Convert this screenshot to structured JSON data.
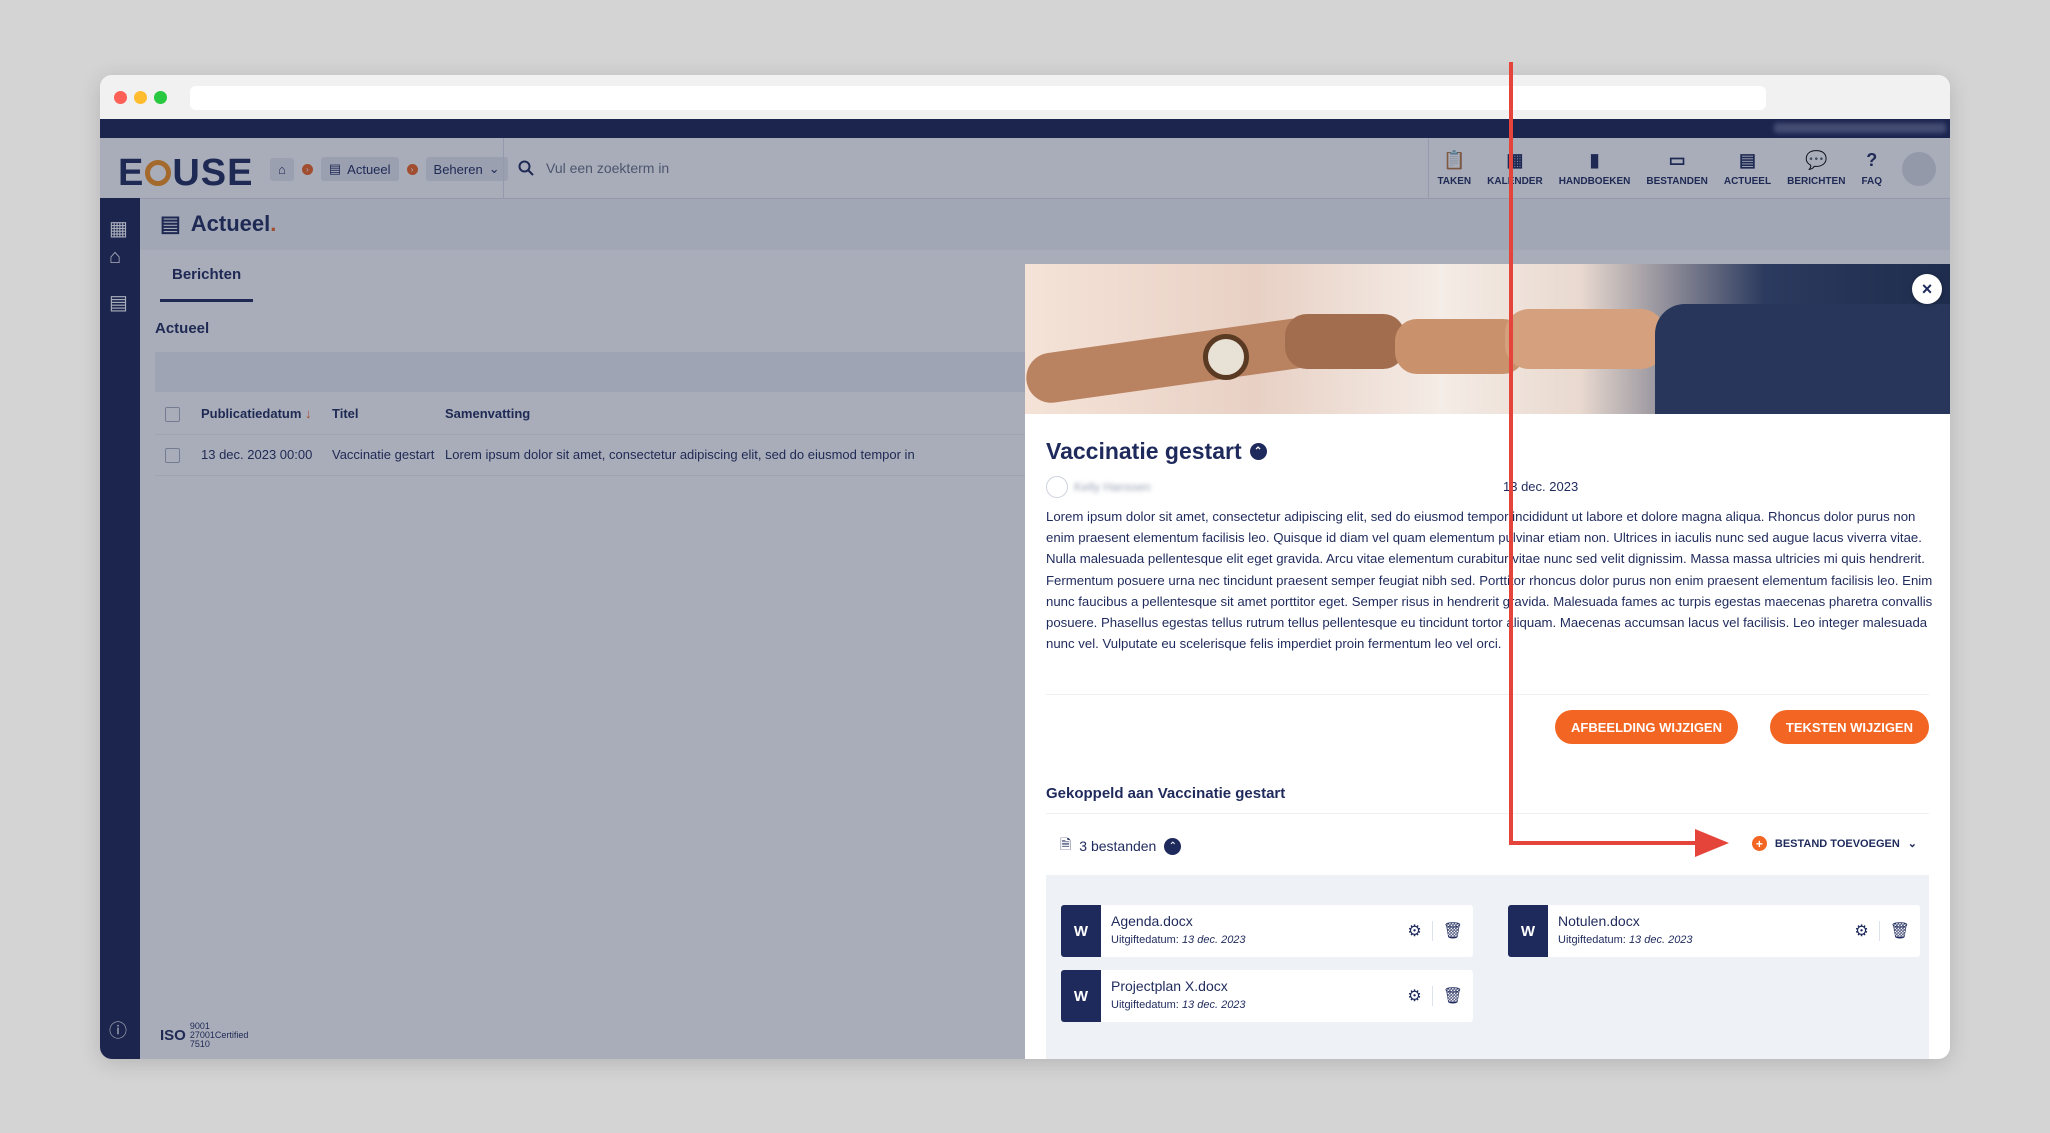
{
  "header": {
    "logo": "EQUSE",
    "breadcrumbs": [
      "Actueel",
      "Beheren"
    ],
    "search_placeholder": "Vul een zoekterm in",
    "nav": [
      {
        "label": "TAKEN",
        "icon": "clipboard-icon"
      },
      {
        "label": "KALENDER",
        "icon": "calendar-icon"
      },
      {
        "label": "HANDBOEKEN",
        "icon": "book-icon"
      },
      {
        "label": "BESTANDEN",
        "icon": "archive-icon"
      },
      {
        "label": "ACTUEEL",
        "icon": "news-icon"
      },
      {
        "label": "BERICHTEN",
        "icon": "chat-icon"
      },
      {
        "label": "FAQ",
        "icon": "question-icon"
      }
    ]
  },
  "page": {
    "title": "Actueel",
    "tab": "Berichten",
    "subtitle": "Actueel",
    "iso_text": [
      "9001",
      "27001Certified",
      "7510"
    ]
  },
  "table": {
    "headers": [
      "Publicatiedatum",
      "Titel",
      "Samenvatting"
    ],
    "rows": [
      {
        "date": "13 dec. 2023 00:00",
        "title": "Vaccinatie gestart",
        "summary": "Lorem ipsum dolor sit amet, consectetur adipiscing elit, sed do eiusmod tempor in"
      }
    ]
  },
  "modal": {
    "title": "Vaccinatie gestart",
    "author": "Kelly Hanssen",
    "date": "13 dec. 2023",
    "body": "Lorem ipsum dolor sit amet, consectetur adipiscing elit, sed do eiusmod tempor incididunt ut labore et dolore magna aliqua. Rhoncus dolor purus non enim praesent elementum facilisis leo. Quisque id diam vel quam elementum pulvinar etiam non. Ultrices in iaculis nunc sed augue lacus viverra vitae. Nulla malesuada pellentesque elit eget gravida. Arcu vitae elementum curabitur vitae nunc sed velit dignissim. Massa massa ultricies mi quis hendrerit. Fermentum posuere urna nec tincidunt praesent semper feugiat nibh sed. Porttitor rhoncus dolor purus non enim praesent elementum facilisis leo. Enim nunc faucibus a pellentesque sit amet porttitor eget. Semper risus in hendrerit gravida. Malesuada fames ac turpis egestas maecenas pharetra convallis posuere. Phasellus egestas tellus rutrum tellus pellentesque eu tincidunt tortor aliquam. Maecenas accumsan lacus vel facilisis. Leo integer malesuada nunc vel. Vulputate eu scelerisque felis imperdiet proin fermentum leo vel orci.",
    "buttons": {
      "change_image": "AFBEELDING WIJZIGEN",
      "change_texts": "TEKSTEN WIJZIGEN"
    },
    "linked_title": "Gekoppeld aan Vaccinatie gestart",
    "file_count": "3 bestanden",
    "add_file": "BESTAND TOEVOEGEN",
    "date_label": "Uitgiftedatum:",
    "files": [
      {
        "name": "Agenda.docx",
        "date": "13 dec. 2023"
      },
      {
        "name": "Notulen.docx",
        "date": "13 dec. 2023"
      },
      {
        "name": "Projectplan X.docx",
        "date": "13 dec. 2023"
      }
    ]
  },
  "colors": {
    "brand_navy": "#1f2a5c",
    "accent_orange": "#f26522",
    "annotation_red": "#e5443a"
  }
}
